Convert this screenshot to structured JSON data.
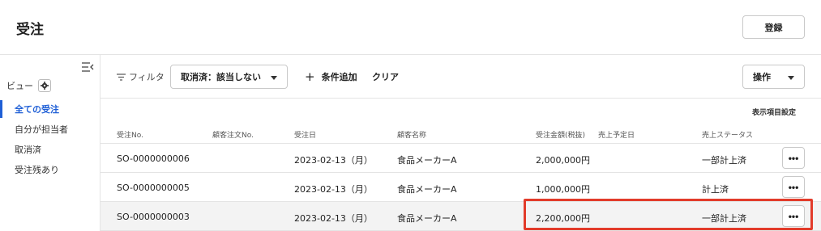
{
  "header": {
    "title": "受注",
    "register_label": "登録"
  },
  "sidebar": {
    "view_label": "ビュー",
    "items": [
      {
        "label": "全ての受注",
        "active": true
      },
      {
        "label": "自分が担当者",
        "active": false
      },
      {
        "label": "取消済",
        "active": false
      },
      {
        "label": "受注残あり",
        "active": false
      }
    ]
  },
  "toolbar": {
    "filter_label": "フィルタ",
    "condition_value": "取消済：該当しない",
    "add_condition_label": "条件追加",
    "clear_label": "クリア",
    "operations_label": "操作"
  },
  "table": {
    "column_settings_label": "表示項目設定",
    "columns": [
      "受注No.",
      "顧客注文No.",
      "受注日",
      "顧客名称",
      "受注金額(税抜)",
      "売上予定日",
      "売上ステータス"
    ],
    "rows": [
      {
        "order_no": "SO-0000000006",
        "customer_order_no": "",
        "order_date": "2023-02-13（月）",
        "customer_name": "食品メーカーA",
        "amount": "2,000,000円",
        "sales_date": "",
        "status": "一部計上済",
        "more": "•••"
      },
      {
        "order_no": "SO-0000000005",
        "customer_order_no": "",
        "order_date": "2023-02-13（月）",
        "customer_name": "食品メーカーA",
        "amount": "1,000,000円",
        "sales_date": "",
        "status": "計上済",
        "more": "•••"
      },
      {
        "order_no": "SO-0000000003",
        "customer_order_no": "",
        "order_date": "2023-02-13（月）",
        "customer_name": "食品メーカーA",
        "amount": "2,200,000円",
        "sales_date": "",
        "status": "一部計上済",
        "more": "•••"
      }
    ]
  },
  "colors": {
    "accent": "#1f5fd6",
    "highlight_box": "#e23b2a",
    "border": "#e4e4e4"
  },
  "icons": {
    "collapse": "collapse-sidebar-icon",
    "gear": "gear-icon",
    "filter": "filter-icon",
    "plus": "plus-icon",
    "caret": "chevron-down-icon",
    "more": "more-horizontal-icon"
  }
}
